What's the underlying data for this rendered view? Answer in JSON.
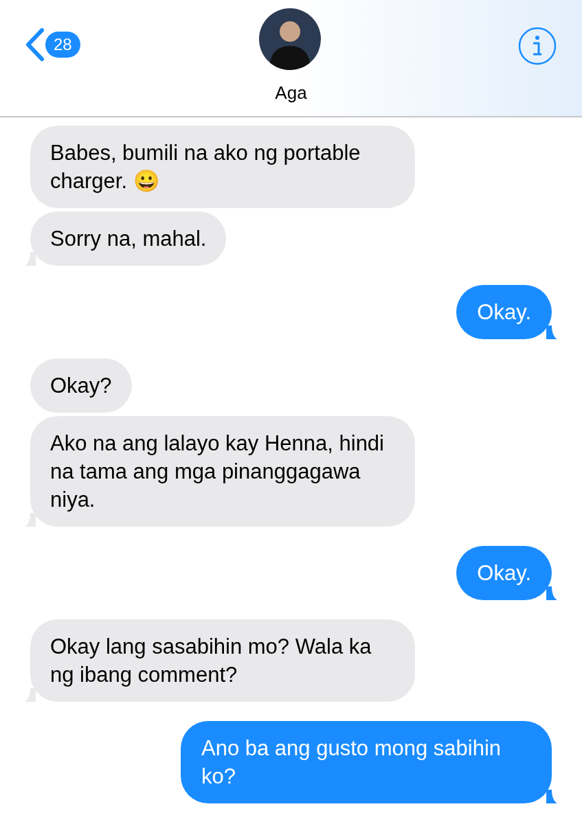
{
  "header": {
    "back_badge": "28",
    "contact_name": "Aga"
  },
  "messages": [
    {
      "kind": "incoming",
      "text": "Babes, bumili na ako ng portable charger. 😀",
      "tail": false
    },
    {
      "kind": "incoming",
      "text": "Sorry na, mahal.",
      "tail": true
    },
    {
      "kind": "outgoing",
      "text": "Okay.",
      "tail": true
    },
    {
      "kind": "incoming",
      "text": "Okay?",
      "tail": false
    },
    {
      "kind": "incoming",
      "text": "Ako na ang lalayo kay Henna, hindi na tama ang mga pinanggagawa niya.",
      "tail": true
    },
    {
      "kind": "outgoing",
      "text": "Okay.",
      "tail": true
    },
    {
      "kind": "incoming",
      "text": "Okay lang sasabihin mo? Wala ka ng ibang comment?",
      "tail": true
    },
    {
      "kind": "outgoing",
      "text": "Ano ba ang gusto mong sabihin ko?",
      "tail": true
    }
  ]
}
